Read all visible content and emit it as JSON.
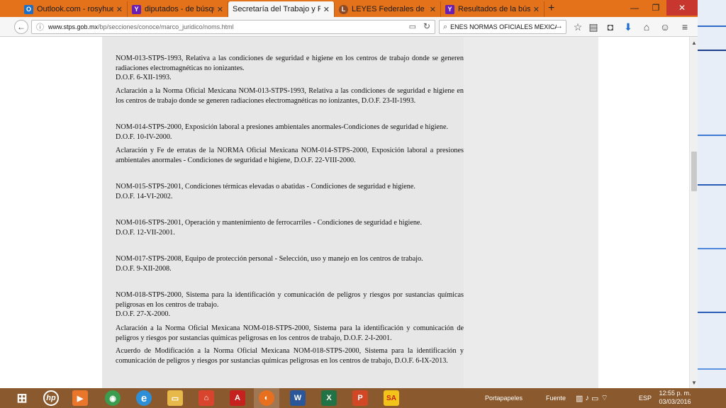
{
  "browser": {
    "tabs": [
      {
        "label": "Outlook.com - rosyhuepa...",
        "icon": "outlook-icon",
        "color": "#1e6fc8",
        "glyph": "O",
        "active": false
      },
      {
        "label": "diputados - de búsqueda",
        "icon": "yahoo-icon",
        "color": "#6b1fb1",
        "glyph": "Y",
        "active": false
      },
      {
        "label": "Secretaría del Trabajo y Previsi...",
        "icon": "page-icon",
        "color": "#ffffff",
        "glyph": "",
        "active": true
      },
      {
        "label": "LEYES Federales de México",
        "icon": "law-site-icon",
        "color": "#8b4a2a",
        "glyph": "L",
        "active": false
      },
      {
        "label": "Resultados de la búsqued...",
        "icon": "yahoo-icon",
        "color": "#6b1fb1",
        "glyph": "Y",
        "active": false
      }
    ],
    "url_domain": "www.stps.gob.mx",
    "url_path": "/bp/secciones/conoce/marco_juridico/noms.html",
    "search_value": "ENES NORMAS OFICIALES MEXICANAS"
  },
  "content": {
    "entries": [
      {
        "paragraphs": [
          "NOM-013-STPS-1993, Relativa a las condiciones de seguridad e higiene en los centros de trabajo donde se generen radiaciones electromagnéticas no ionizantes.",
          "D.O.F. 6-XII-1993."
        ]
      },
      {
        "paragraphs": [
          "Aclaración a la Norma Oficial Mexicana NOM-013-STPS-1993, Relativa a las condiciones de seguridad e higiene en los centros de trabajo donde se generen radiaciones electromagnéticas no ionizantes, D.O.F. 23-II-1993."
        ]
      },
      {
        "paragraphs": [
          "NOM-014-STPS-2000, Exposición laboral a presiones ambientales anormales-Condiciones de seguridad e higiene.",
          "D.O.F. 10-IV-2000."
        ]
      },
      {
        "paragraphs": [
          "Aclaración y Fe de erratas de la NORMA Oficial Mexicana NOM-014-STPS-2000, Exposición laboral a presiones ambientales anormales - Condiciones de seguridad e higiene, D.O.F. 22-VIII-2000."
        ]
      },
      {
        "paragraphs": [
          "NOM-015-STPS-2001, Condiciones térmicas elevadas o abatidas - Condiciones de seguridad e higiene.",
          "D.O.F. 14-VI-2002."
        ]
      },
      {
        "paragraphs": [
          "NOM-016-STPS-2001, Operación y mantenimiento de ferrocarriles - Condiciones de seguridad e higiene.",
          "D.O.F. 12-VII-2001."
        ]
      },
      {
        "paragraphs": [
          "NOM-017-STPS-2008, Equipo de protección personal - Selección, uso y manejo en los centros de trabajo.",
          "D.O.F. 9-XII-2008."
        ]
      },
      {
        "paragraphs": [
          "NOM-018-STPS-2000, Sistema para la identificación y comunicación de peligros y riesgos por sustancias químicas peligrosas en los centros de trabajo.",
          "D.O.F. 27-X-2000."
        ]
      },
      {
        "paragraphs": [
          "Aclaración a la Norma Oficial Mexicana NOM-018-STPS-2000, Sistema para la identificación y comunicación de peligros y riesgos por sustancias químicas peligrosas en los centros de trabajo, D.O.F. 2-I-2001."
        ]
      },
      {
        "paragraphs": [
          "Acuerdo de Modificación a la Norma Oficial Mexicana NOM-018-STPS-2000, Sistema para la identificación y comunicación de peligros y riesgos por sustancias químicas peligrosas en los centros de trabajo, D.O.F. 6-IX-2013."
        ]
      }
    ]
  },
  "taskbar": {
    "apps": [
      {
        "name": "start-button",
        "glyph": "⊞",
        "color": "#8a5a2e"
      },
      {
        "name": "hp-app",
        "glyph": "hp",
        "color": "#8a5a2e"
      },
      {
        "name": "media-app",
        "glyph": "▶",
        "color": "#e9762b"
      },
      {
        "name": "chrome-app",
        "glyph": "◉",
        "color": "#3a9d4f"
      },
      {
        "name": "ie-app",
        "glyph": "e",
        "color": "#2d8fd8"
      },
      {
        "name": "explorer-app",
        "glyph": "▭",
        "color": "#e7b94a"
      },
      {
        "name": "store-app",
        "glyph": "⌂",
        "color": "#d9442f"
      },
      {
        "name": "acrobat-app",
        "glyph": "A",
        "color": "#c5221f"
      },
      {
        "name": "firefox-app",
        "glyph": "◐",
        "color": "#e86f1e"
      },
      {
        "name": "word-app",
        "glyph": "W",
        "color": "#2b579a"
      },
      {
        "name": "excel-app",
        "glyph": "X",
        "color": "#217346"
      },
      {
        "name": "powerpoint-app",
        "glyph": "P",
        "color": "#d24726"
      },
      {
        "name": "sa-app",
        "glyph": "SA",
        "color": "#f2c318"
      }
    ],
    "tray_label": "Portapapeles",
    "tray_label2": "Fuente",
    "lang": "ESP",
    "time": "12:55 p. m.",
    "date": "03/03/2016"
  }
}
